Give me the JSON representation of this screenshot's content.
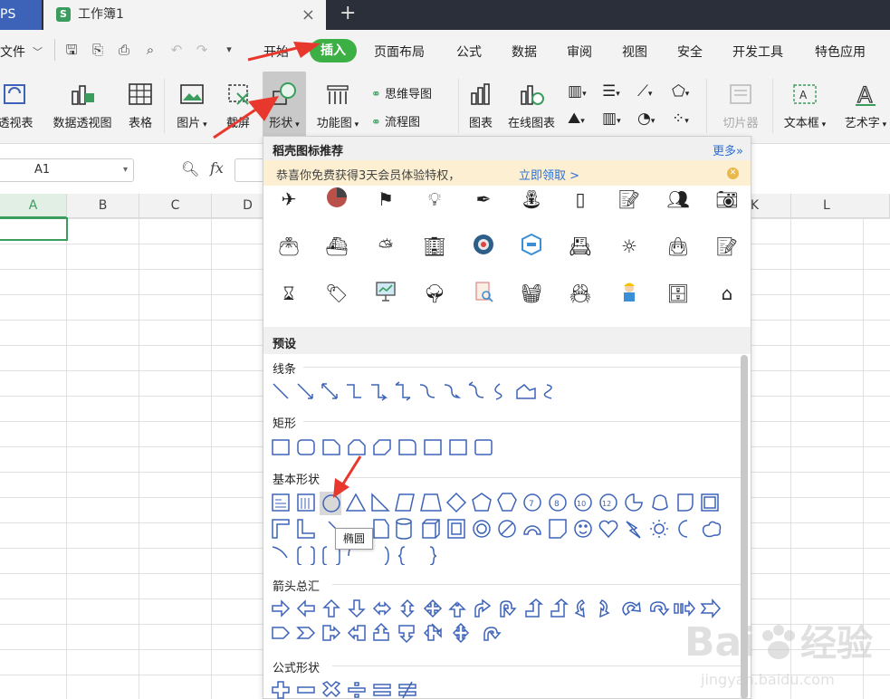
{
  "tabs": {
    "wps": "PS",
    "book": "工作簿1",
    "book_logo": "S",
    "close": "×",
    "add": "+"
  },
  "menu": {
    "file": "文件",
    "items": [
      "开始",
      "插入",
      "页面布局",
      "公式",
      "数据",
      "审阅",
      "视图",
      "安全",
      "开发工具",
      "特色应用"
    ],
    "active": "插入"
  },
  "ribbon": {
    "pivot_table_partial": "透视表",
    "pivot_chart": "数据透视图",
    "table": "表格",
    "picture": "图片",
    "screenshot": "截屏",
    "shapes": "形状",
    "function_chart": "功能图",
    "mind_map": "思维导图",
    "flowchart": "流程图",
    "chart": "图表",
    "online_chart": "在线图表",
    "slicer": "切片器",
    "textbox": "文本框",
    "art_text": "艺术字"
  },
  "formula_bar": {
    "cell_ref": "A1",
    "fx": "fx"
  },
  "columns": [
    "A",
    "B",
    "C",
    "D",
    "K",
    "L"
  ],
  "panel": {
    "title": "稻壳图标推荐",
    "more": "更多»",
    "promo_text": "恭喜你免费获得3天会员体验特权，",
    "promo_link": "立即领取 >",
    "presets": "预设",
    "sections": {
      "lines": "线条",
      "rect": "矩形",
      "basic": "基本形状",
      "arrows": "箭头总汇",
      "formula": "公式形状"
    },
    "tooltip": "椭圆"
  },
  "icons": [
    "satellite-icon",
    "pie-chart-icon",
    "flag-icon",
    "lightbulb-icon",
    "pen-icon",
    "fountain-icon",
    "bookmark-icon",
    "notes-icon",
    "users-icon",
    "camera-icon",
    "wallet-icon",
    "boat-icon",
    "weather-icon",
    "building-icon",
    "target-icon",
    "hexagon-icon",
    "contacts-icon",
    "sun-icon",
    "bag-icon",
    "edit-icon",
    "hourglass-icon",
    "sale-icon",
    "presentation-icon",
    "tree-icon",
    "search-doc-icon",
    "basket-icon",
    "crab-icon",
    "worker-icon",
    "cabinet-icon",
    "house-icon"
  ],
  "colors": {
    "accent_green": "#3cb045",
    "link_blue": "#2c6fd6",
    "arrow_red": "#e8382e",
    "shape_blue": "#3d63b8"
  }
}
